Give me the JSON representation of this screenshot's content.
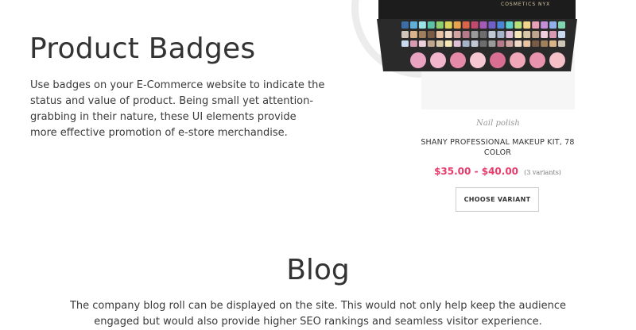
{
  "badges_section": {
    "title": "Product Badges",
    "description": "Use badges on your E-Commerce website to indicate the status and value of product. Being small yet attention-grabbing in their nature, these UI elements provide more effective promotion of e-store merchandise."
  },
  "product": {
    "image_icon": "makeup-palette-image",
    "brand_text": "COSMETICS  NYX",
    "category": "Nail polish",
    "name": "SHANY PROFESSIONAL MAKEUP KIT, 78 COLOR",
    "price": "$35.00 - $40.00",
    "variants": "(3 variants)",
    "button_label": "CHOOSE VARIANT",
    "price_color": "#e83a6b"
  },
  "blog_section": {
    "title": "Blog",
    "description": "The company blog roll can be displayed on the site. This would not only help keep the audience engaged but would also provide higher SEO rankings and seamless visitor experience."
  }
}
